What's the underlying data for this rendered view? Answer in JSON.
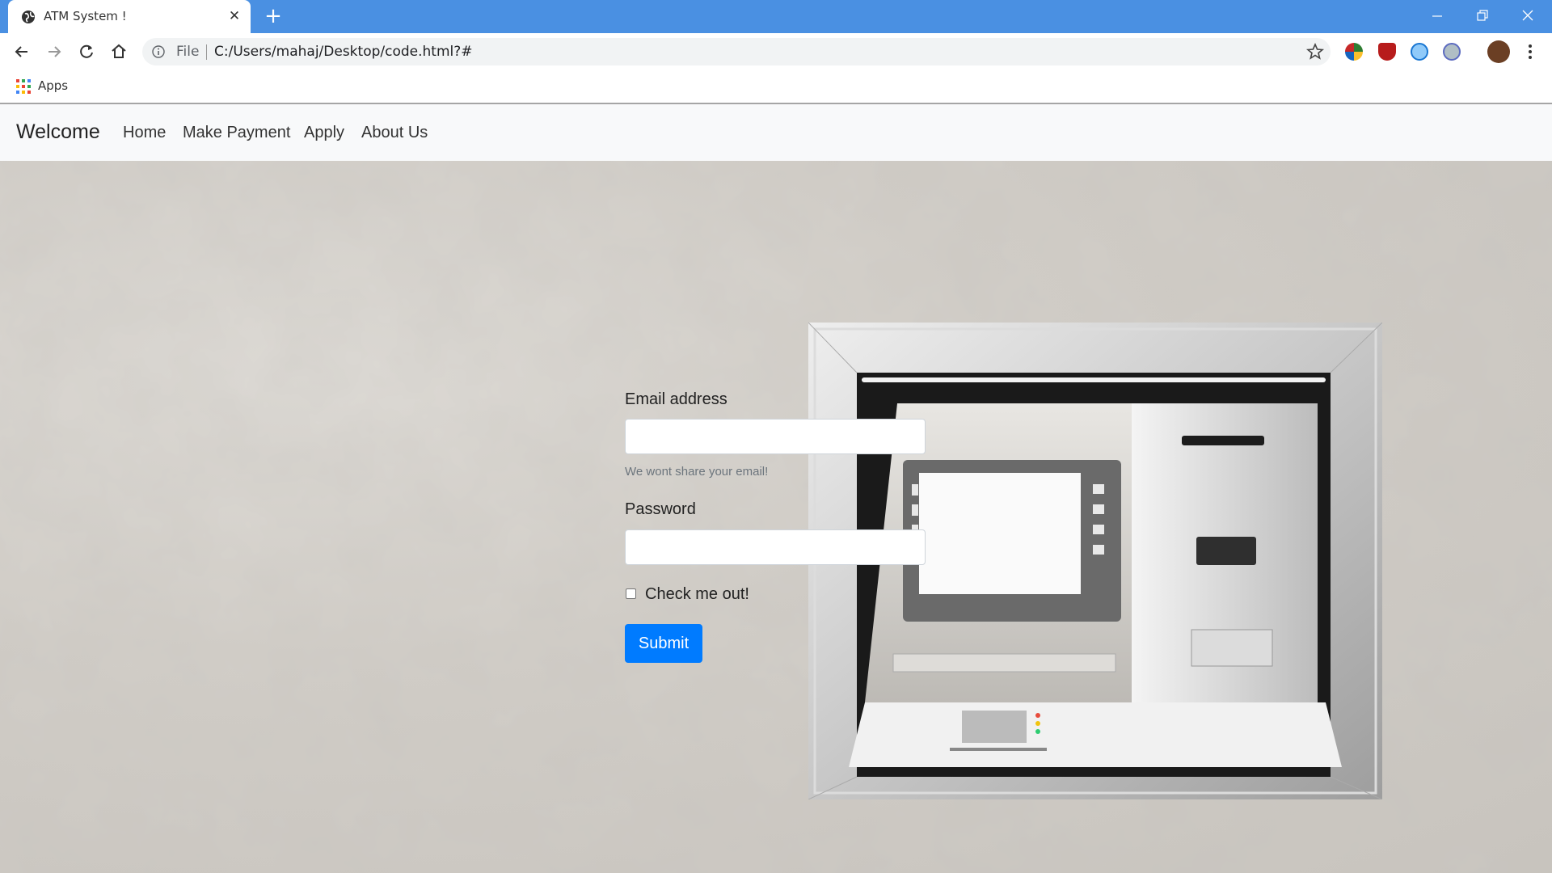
{
  "browser": {
    "tab_title": "ATM System !",
    "file_label": "File",
    "url": "C:/Users/mahaj/Desktop/code.html?#",
    "bookmarks_apps_label": "Apps",
    "titlebar_color": "#4a90e2"
  },
  "navbar": {
    "brand": "Welcome",
    "links": [
      "Home",
      "Make Payment",
      "Apply",
      "About Us"
    ]
  },
  "form": {
    "email_label": "Email address",
    "email_value": "",
    "email_help": "We wont share your email!",
    "password_label": "Password",
    "password_value": "",
    "checkbox_label": "Check me out!",
    "checkbox_checked": false,
    "submit_label": "Submit",
    "accent_color": "#007bff"
  }
}
